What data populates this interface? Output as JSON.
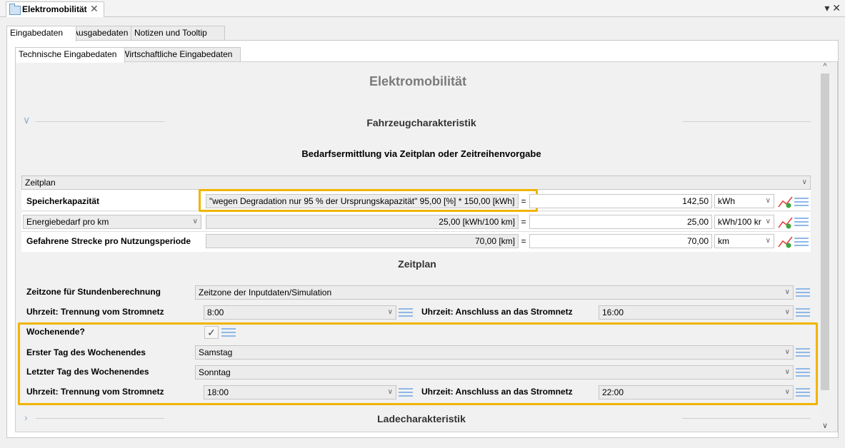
{
  "window": {
    "tab_title": "Elektromobilität",
    "close_glyph": "✕",
    "controls_glyph": "▾ ✕"
  },
  "tabs_main": [
    "Eingabedaten",
    "Ausgabedaten",
    "Notizen und Tooltip"
  ],
  "tabs_sub": [
    "Technische Eingabedaten",
    "Wirtschaftliche Eingabedaten"
  ],
  "page_title": "Elektromobilität",
  "section_fahrzeug": "Fahrzeugcharakteristik",
  "subsection_bedarf": "Bedarfsermittlung via Zeitplan oder Zeitreihenvorgabe",
  "mode_select": "Zeitplan",
  "rows": {
    "speicher": {
      "label": "Speicherkapazität",
      "formula": "\"wegen Degradation nur 95 % der Ursprungskapazität\" 95,00 [%] * 150,00 [kWh]",
      "eq": "=",
      "value": "142,50",
      "unit": "kWh"
    },
    "energie": {
      "label": "Energiebedarf pro km",
      "formula": "25,00 [kWh/100 km]",
      "eq": "=",
      "value": "25,00",
      "unit": "kWh/100 kr"
    },
    "strecke": {
      "label": "Gefahrene Strecke pro Nutzungsperiode",
      "formula": "70,00 [km]",
      "eq": "=",
      "value": "70,00",
      "unit": "km"
    }
  },
  "section_zeitplan": "Zeitplan",
  "zeitzone": {
    "label": "Zeitzone für Stundenberechnung",
    "value": "Zeitzone der Inputdaten/Simulation"
  },
  "werktag": {
    "trennung_label": "Uhrzeit: Trennung vom Stromnetz",
    "trennung_value": "8:00",
    "anschluss_label": "Uhrzeit: Anschluss an das Stromnetz",
    "anschluss_value": "16:00"
  },
  "wochenende": {
    "label": "Wochenende?",
    "checked_glyph": "✓",
    "erster_label": "Erster Tag des Wochenendes",
    "erster_value": "Samstag",
    "letzter_label": "Letzter Tag des Wochenendes",
    "letzter_value": "Sonntag",
    "trennung_label": "Uhrzeit: Trennung vom Stromnetz",
    "trennung_value": "18:00",
    "anschluss_label": "Uhrzeit: Anschluss an das Stromnetz",
    "anschluss_value": "22:00"
  },
  "section_lade": "Ladecharakteristik",
  "glyphs": {
    "dropdown": "∨",
    "collapse_open": "∨",
    "collapse_closed": "›",
    "scroll_up": "^",
    "scroll_down": "∨"
  },
  "colors": {
    "highlight": "#f0b400",
    "list_icon": "#8fb8e8",
    "chart_red": "#e0403a",
    "chart_green": "#3aa63a"
  },
  "icons": [
    "list-icon",
    "chart-icon",
    "checkbox-icon",
    "file-icon"
  ]
}
